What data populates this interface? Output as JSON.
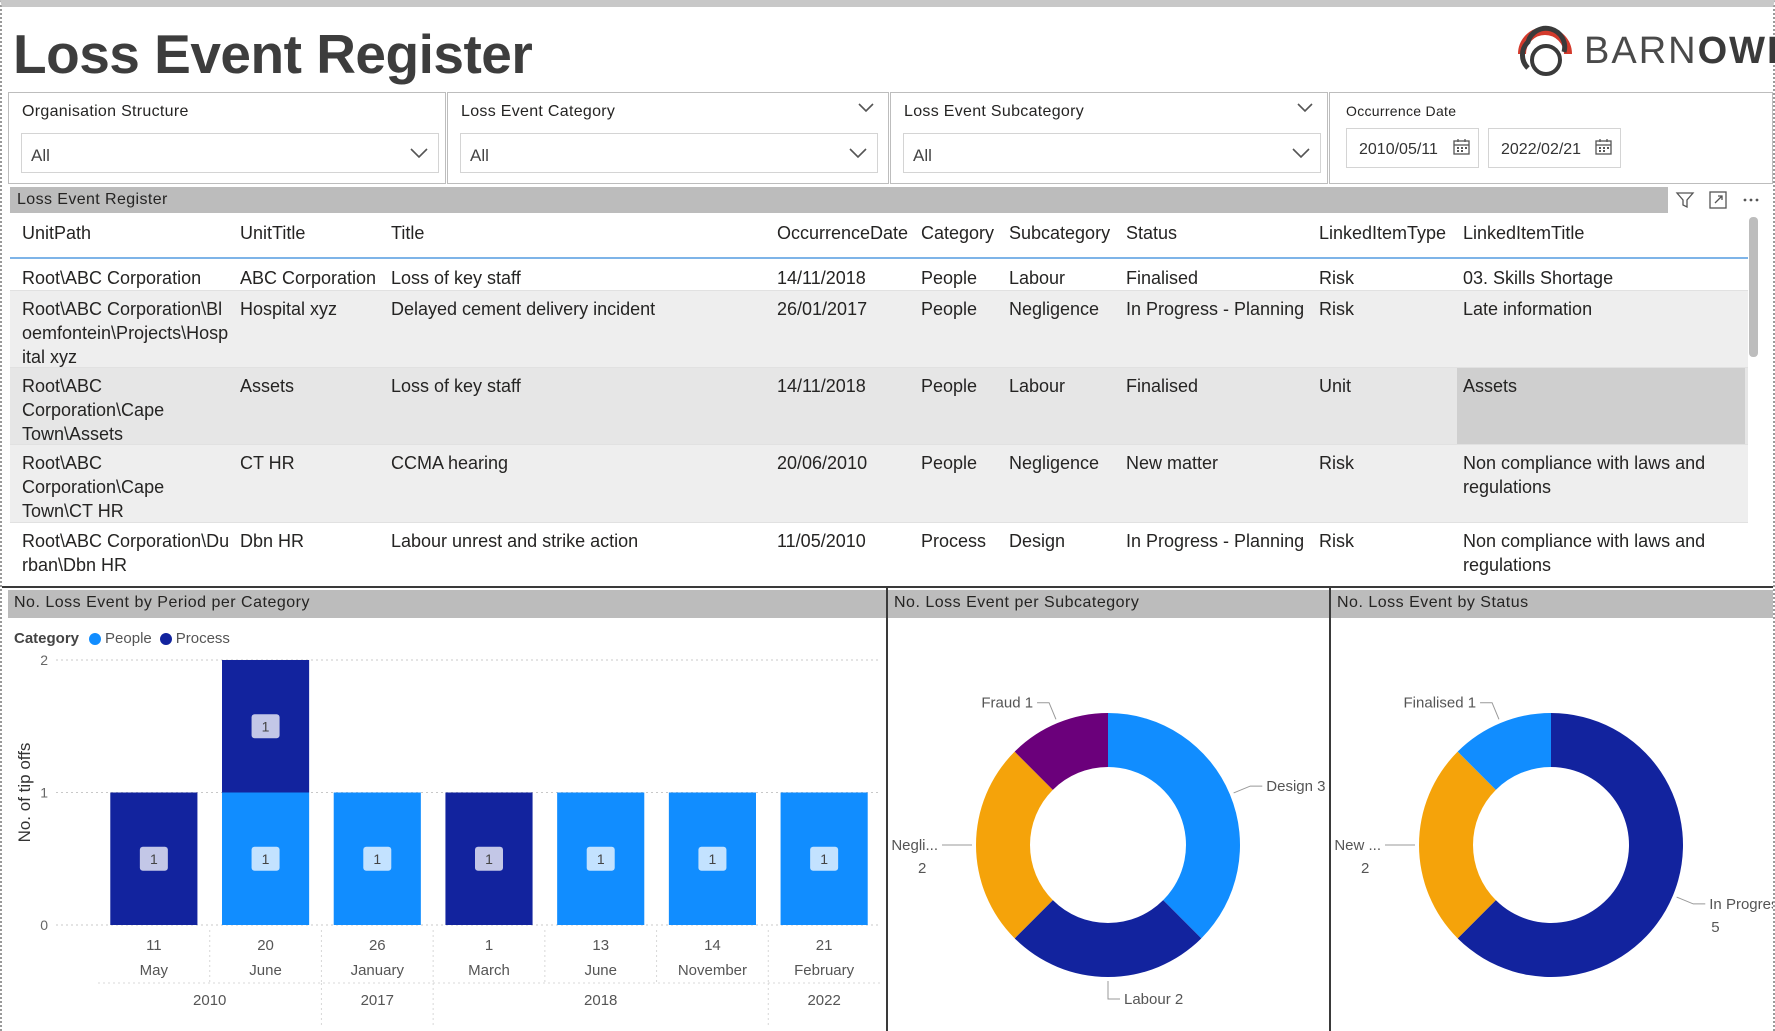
{
  "page": {
    "title": "Loss Event Register"
  },
  "logo": {
    "brand": "BARNOWL",
    "brand_light": "BARN",
    "brand_bold": "OWL"
  },
  "slicers": {
    "organisation": {
      "label": "Organisation Structure",
      "value": "All"
    },
    "category": {
      "label": "Loss Event Category",
      "value": "All"
    },
    "subcategory": {
      "label": "Loss Event Subcategory",
      "value": "All"
    },
    "date": {
      "label": "Occurrence Date",
      "from": "2010/05/11",
      "to": "2022/02/21"
    }
  },
  "table": {
    "title": "Loss Event Register",
    "columns": [
      "UnitPath",
      "UnitTitle",
      "Title",
      "OccurrenceDate",
      "Category",
      "Subcategory",
      "Status",
      "LinkedItemType",
      "LinkedItemTitle"
    ],
    "rows": [
      [
        "Root\\ABC Corporation",
        "ABC Corporation",
        "Loss of key staff",
        "14/11/2018",
        "People",
        "Labour",
        "Finalised",
        "Risk",
        "03. Skills Shortage"
      ],
      [
        "Root\\ABC Corporation\\Bloemfontein\\Projects\\Hospital xyz",
        "Hospital xyz",
        "Delayed cement delivery incident",
        "26/01/2017",
        "People",
        "Negligence",
        "In Progress - Planning",
        "Risk",
        "Late information"
      ],
      [
        "Root\\ABC Corporation\\Cape Town\\Assets",
        "Assets",
        "Loss of key staff",
        "14/11/2018",
        "People",
        "Labour",
        "Finalised",
        "Unit",
        "Assets"
      ],
      [
        "Root\\ABC Corporation\\Cape Town\\CT HR",
        "CT HR",
        "CCMA hearing",
        "20/06/2010",
        "People",
        "Negligence",
        "New matter",
        "Risk",
        "Non compliance with laws and regulations"
      ],
      [
        "Root\\ABC Corporation\\Durban\\Dbn HR",
        "Dbn HR",
        "Labour unrest and strike action",
        "11/05/2010",
        "Process",
        "Design",
        "In Progress - Planning",
        "Risk",
        "Non compliance with laws and regulations"
      ]
    ]
  },
  "charts": {
    "period": {
      "title": "No. Loss Event by Period per Category",
      "legend_title": "Category",
      "ylabel": "No. of tip offs"
    },
    "subcategory": {
      "title": "No. Loss Event per Subcategory"
    },
    "status": {
      "title": "No. Loss Event by Status"
    }
  },
  "colors": {
    "people": "#118dff",
    "process": "#12239e",
    "orange": "#f5a30a",
    "purple": "#6b007b",
    "header_grey": "#bcbcbc"
  },
  "chart_data": [
    {
      "type": "bar",
      "stacked": true,
      "title": "No. Loss Event by Period per Category",
      "ylabel": "No. of tip offs",
      "ylim": [
        0,
        2
      ],
      "yticks": [
        0,
        1,
        2
      ],
      "categories": [
        "11",
        "20",
        "26",
        "1",
        "13",
        "14",
        "21"
      ],
      "months": [
        "May",
        "June",
        "January",
        "March",
        "June",
        "November",
        "February"
      ],
      "years": [
        {
          "label": "2010",
          "span": 2
        },
        {
          "label": "2017",
          "span": 1
        },
        {
          "label": "2018",
          "span": 3
        },
        {
          "label": "2022",
          "span": 1
        }
      ],
      "series": [
        {
          "name": "People",
          "color": "#118dff",
          "values": [
            0,
            1,
            1,
            0,
            1,
            1,
            1
          ]
        },
        {
          "name": "Process",
          "color": "#12239e",
          "values": [
            1,
            1,
            0,
            1,
            0,
            0,
            0
          ]
        }
      ],
      "legend": "top-left"
    },
    {
      "type": "pie",
      "donut": true,
      "title": "No. Loss Event per Subcategory",
      "slices": [
        {
          "label": "Design",
          "value": 3,
          "color": "#118dff",
          "display": "Design 3"
        },
        {
          "label": "Labour",
          "value": 2,
          "color": "#12239e",
          "display": "Labour 2"
        },
        {
          "label": "Negligence",
          "value": 2,
          "color": "#f5a30a",
          "display": "Negli...",
          "display2": "2"
        },
        {
          "label": "Fraud",
          "value": 1,
          "color": "#6b007b",
          "display": "Fraud 1"
        }
      ]
    },
    {
      "type": "pie",
      "donut": true,
      "title": "No. Loss Event by Status",
      "slices": [
        {
          "label": "In Progress - Planning",
          "value": 5,
          "color": "#12239e",
          "display": "In Progress - Planning",
          "display2": "5"
        },
        {
          "label": "New matter",
          "value": 2,
          "color": "#f5a30a",
          "display": "New ...",
          "display2": "2"
        },
        {
          "label": "Finalised",
          "value": 1,
          "color": "#118dff",
          "display": "Finalised 1"
        }
      ]
    }
  ]
}
